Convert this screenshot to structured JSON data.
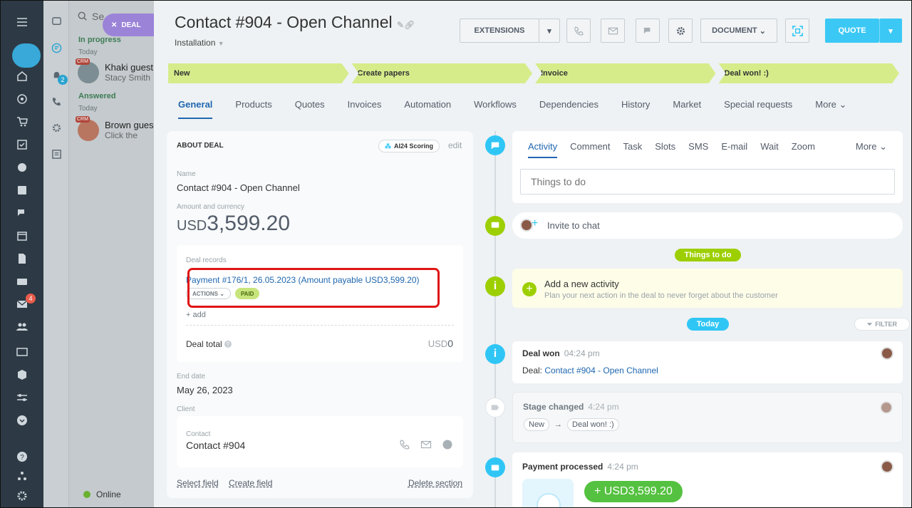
{
  "deal_tag": {
    "label": "DEAL"
  },
  "chat_panel": {
    "search_placeholder": "Se",
    "in_progress": "In progress",
    "today": "Today",
    "answered": "Answered",
    "today2": "Today",
    "online": "Online",
    "items": [
      {
        "badge": "CRM",
        "name": "Khaki guest",
        "sub": "Stacy Smith"
      },
      {
        "badge": "CRM",
        "name": "Brown gues",
        "sub": "Click the"
      }
    ]
  },
  "left_badges": {
    "chat_count": "2",
    "mail_count": "4"
  },
  "header": {
    "title": "Contact #904 - Open Channel",
    "subtitle": "Installation",
    "extensions": "EXTENSIONS",
    "document": "DOCUMENT",
    "quote": "QUOTE"
  },
  "stages": [
    "New",
    "Create papers",
    "Invoice",
    "Deal won! :)"
  ],
  "tabs": [
    "General",
    "Products",
    "Quotes",
    "Invoices",
    "Automation",
    "Workflows",
    "Dependencies",
    "History",
    "Market",
    "Special requests",
    "More"
  ],
  "about": {
    "heading": "ABOUT DEAL",
    "scoring": "AI24 Scoring",
    "edit": "edit",
    "name_label": "Name",
    "name_value": "Contact #904 - Open Channel",
    "amount_label": "Amount and currency",
    "currency": "USD",
    "amount": "3,599.20",
    "records_label": "Deal records",
    "payment": "Payment #176/1, 26.05.2023 (Amount payable USD3,599.20)",
    "actions": "ACTIONS",
    "paid": "PAID",
    "add": "+ add",
    "deal_total": "Deal total",
    "deal_total_currency": "USD",
    "deal_total_value": "0",
    "end_label": "End date",
    "end_value": "May 26, 2023",
    "client_label": "Client",
    "contact_label": "Contact",
    "contact_value": "Contact #904",
    "select_field": "Select field",
    "create_field": "Create field",
    "delete_section": "Delete section"
  },
  "activity": {
    "tabs": [
      "Activity",
      "Comment",
      "Task",
      "Slots",
      "SMS",
      "E-mail",
      "Wait",
      "Zoom"
    ],
    "more": "More",
    "placeholder": "Things to do",
    "invite": "Invite to chat",
    "things_to_do": "Things to do",
    "add_title": "Add a new activity",
    "add_sub": "Plan your next action in the deal to never forget about the customer",
    "today": "Today",
    "filter": "FILTER",
    "deal_won": {
      "title": "Deal won",
      "time": "04:24 pm",
      "prefix": "Deal:",
      "link": "Contact #904 - Open Channel"
    },
    "stage_changed": {
      "title": "Stage changed",
      "time": "4:24 pm",
      "from": "New",
      "arrow": "→",
      "to": "Deal won! :)"
    },
    "payment": {
      "title": "Payment processed",
      "time": "4:24 pm",
      "amount": "+ USD3,599.20"
    }
  },
  "colors": {
    "accent": "#2067b0",
    "stage": "#d6ec8a",
    "quote": "#3bc8f5",
    "paid": "#c7e57c",
    "timeline_green": "#9dcf00",
    "timeline_blue": "#2fc6f6"
  }
}
